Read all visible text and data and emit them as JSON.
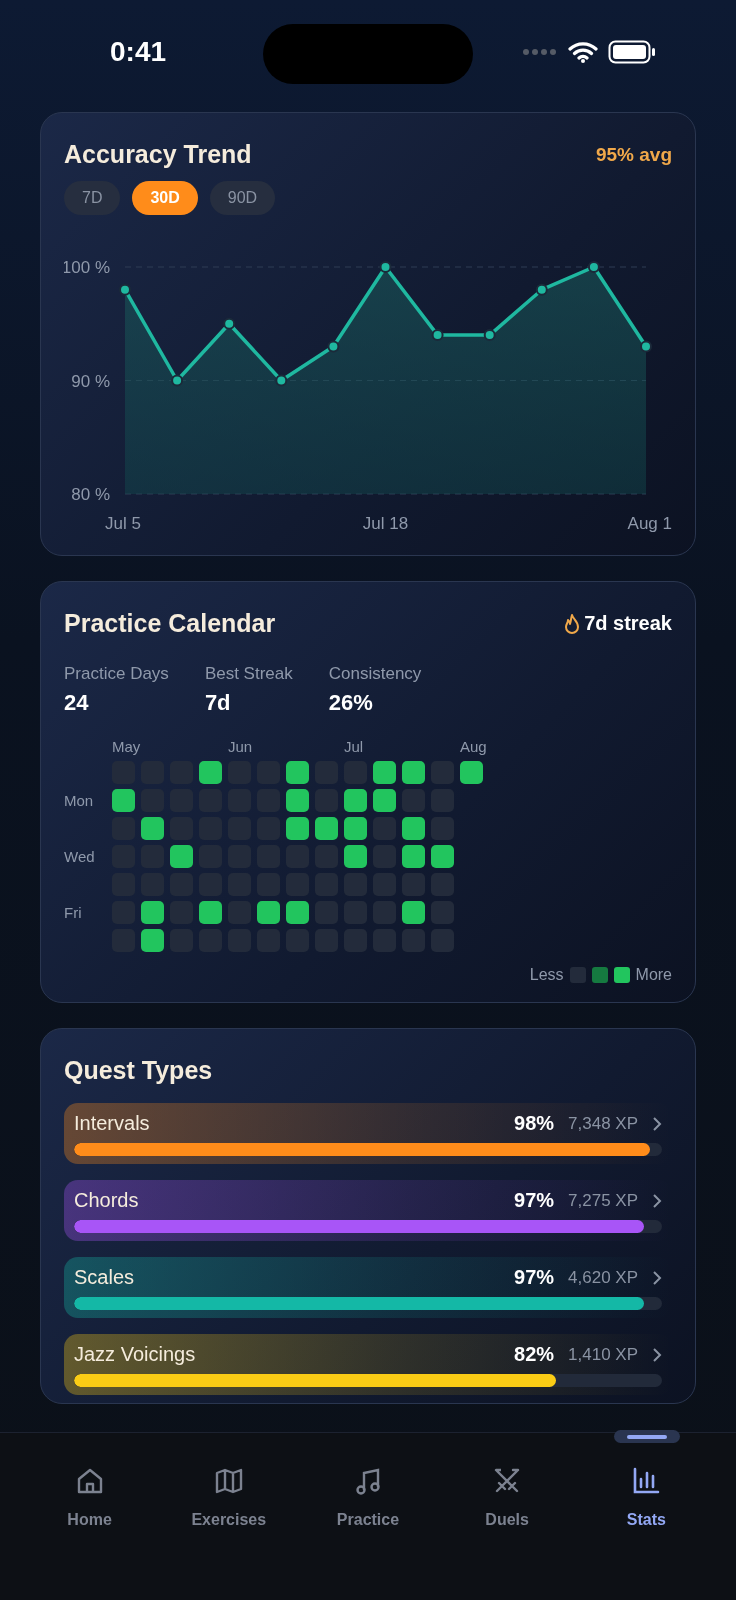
{
  "status_bar": {
    "time": "0:41"
  },
  "accuracy": {
    "title": "Accuracy Trend",
    "average": "95% avg",
    "ranges": [
      {
        "label": "7D",
        "selected": false
      },
      {
        "label": "30D",
        "selected": true
      },
      {
        "label": "90D",
        "selected": false
      }
    ],
    "chart_data": {
      "type": "area",
      "categories": [
        "Jul 5",
        null,
        null,
        null,
        null,
        "Jul 18",
        null,
        null,
        null,
        null,
        "Aug 1"
      ],
      "series": [
        {
          "color": "#1fb8a0",
          "values": [
            98,
            90,
            95,
            90,
            93,
            100,
            94,
            94,
            98,
            100,
            93
          ]
        }
      ],
      "ylim": [
        80,
        100
      ],
      "yticks": [
        {
          "value": 80,
          "label": "80 %"
        },
        {
          "value": 90,
          "label": "90 %"
        },
        {
          "value": 100,
          "label": "100 %"
        }
      ]
    }
  },
  "calendar": {
    "title": "Practice Calendar",
    "streak": "7d streak",
    "stats": [
      {
        "label": "Practice Days",
        "value": "24"
      },
      {
        "label": "Best Streak",
        "value": "7d"
      },
      {
        "label": "Consistency",
        "value": "26%"
      }
    ],
    "rows": [
      {
        "cells": [
          {
            "active": false,
            "month": "May"
          },
          {
            "active": false
          },
          {
            "active": false
          },
          {
            "active": true
          },
          {
            "active": false,
            "month": "Jun"
          },
          {
            "active": false
          },
          {
            "active": true
          },
          {
            "active": false
          },
          {
            "active": false,
            "month": "Jul"
          },
          {
            "active": true
          },
          {
            "active": true
          },
          {
            "active": false
          },
          {
            "active": true,
            "month": "Aug"
          }
        ]
      },
      {
        "label": "Mon",
        "cells": [
          {
            "active": true
          },
          {
            "active": false
          },
          {
            "active": false
          },
          {
            "active": false
          },
          {
            "active": false
          },
          {
            "active": false
          },
          {
            "active": true
          },
          {
            "active": false
          },
          {
            "active": true
          },
          {
            "active": true
          },
          {
            "active": false
          },
          {
            "active": false
          }
        ]
      },
      {
        "cells": [
          {
            "active": false
          },
          {
            "active": true
          },
          {
            "active": false
          },
          {
            "active": false
          },
          {
            "active": false
          },
          {
            "active": false
          },
          {
            "active": true
          },
          {
            "active": true
          },
          {
            "active": true
          },
          {
            "active": false
          },
          {
            "active": true
          },
          {
            "active": false
          }
        ]
      },
      {
        "label": "Wed",
        "cells": [
          {
            "active": false
          },
          {
            "active": false
          },
          {
            "active": true
          },
          {
            "active": false
          },
          {
            "active": false
          },
          {
            "active": false
          },
          {
            "active": false
          },
          {
            "active": false
          },
          {
            "active": true
          },
          {
            "active": false
          },
          {
            "active": true
          },
          {
            "active": true
          }
        ]
      },
      {
        "cells": [
          {
            "active": false
          },
          {
            "active": false
          },
          {
            "active": false
          },
          {
            "active": false
          },
          {
            "active": false
          },
          {
            "active": false
          },
          {
            "active": false
          },
          {
            "active": false
          },
          {
            "active": false
          },
          {
            "active": false
          },
          {
            "active": false
          },
          {
            "active": false
          }
        ]
      },
      {
        "label": "Fri",
        "cells": [
          {
            "active": false
          },
          {
            "active": true
          },
          {
            "active": false
          },
          {
            "active": true
          },
          {
            "active": false
          },
          {
            "active": true
          },
          {
            "active": true
          },
          {
            "active": false
          },
          {
            "active": false
          },
          {
            "active": false
          },
          {
            "active": true
          },
          {
            "active": false
          }
        ]
      },
      {
        "cells": [
          {
            "active": false
          },
          {
            "active": true
          },
          {
            "active": false
          },
          {
            "active": false
          },
          {
            "active": false
          },
          {
            "active": false
          },
          {
            "active": false
          },
          {
            "active": false
          },
          {
            "active": false
          },
          {
            "active": false
          },
          {
            "active": false
          },
          {
            "active": false
          }
        ]
      }
    ],
    "legend": {
      "less": "Less",
      "more": "More"
    }
  },
  "quests": {
    "title": "Quest Types",
    "items": [
      {
        "name": "Intervals",
        "percent": "98%",
        "xp": "7,348 XP",
        "level": 0.98,
        "color": "#ff8c1a"
      },
      {
        "name": "Chords",
        "percent": "97%",
        "xp": "7,275 XP",
        "level": 0.97,
        "color": "#a855f7"
      },
      {
        "name": "Scales",
        "percent": "97%",
        "xp": "4,620 XP",
        "level": 0.97,
        "color": "#14b8a6"
      },
      {
        "name": "Jazz Voicings",
        "percent": "82%",
        "xp": "1,410 XP",
        "level": 0.82,
        "color": "#facc15"
      }
    ]
  },
  "tab_bar": {
    "items": [
      {
        "label": "Home",
        "selected": false
      },
      {
        "label": "Exercises",
        "selected": false
      },
      {
        "label": "Practice",
        "selected": false
      },
      {
        "label": "Duels",
        "selected": false
      },
      {
        "label": "Stats",
        "selected": true
      }
    ]
  }
}
